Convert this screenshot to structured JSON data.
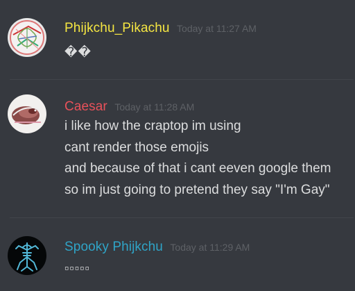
{
  "messages": [
    {
      "username": "Phijkchu_Pikachu",
      "username_color": "#f5e642",
      "timestamp": "Today at 11:27 AM",
      "lines": [
        "��"
      ],
      "avatar": "clover-sketch-avatar"
    },
    {
      "username": "Caesar",
      "username_color": "#e8515a",
      "timestamp": "Today at 11:28 AM",
      "lines": [
        "i like how the craptop im using",
        "cant render those emojis",
        "and because of that i cant eeven google them",
        "so im just going to pretend they say \"I'm Gay\""
      ],
      "avatar": "bird-photo-avatar"
    },
    {
      "username": "Spooky Phijkchu",
      "username_color": "#2fa4c7",
      "timestamp": "Today at 11:29 AM",
      "lines": [
        "▫▫▫▫▫"
      ],
      "avatar": "frog-skeleton-avatar"
    }
  ]
}
